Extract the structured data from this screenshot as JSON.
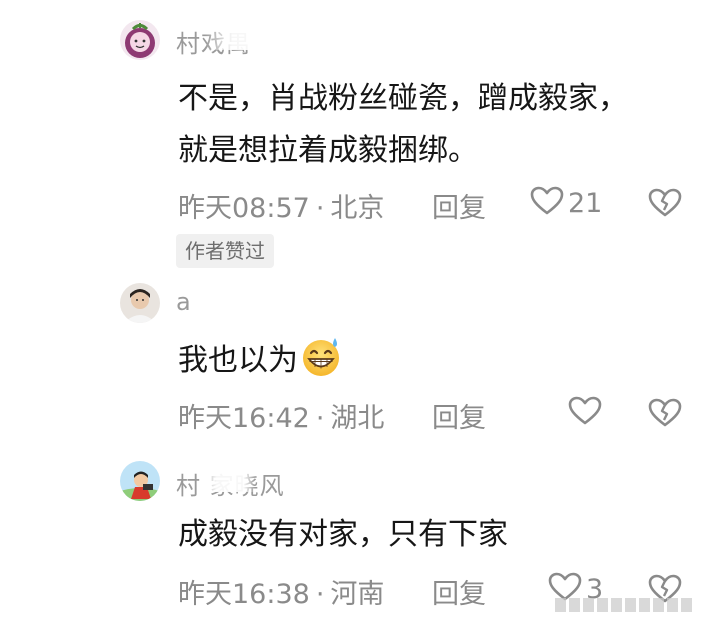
{
  "comments": [
    {
      "username": "村戏禺",
      "text_lines": [
        "不是，肖战粉丝碰瓷，蹭成毅家，",
        "就是想拉着成毅捆绑。"
      ],
      "time": "昨天08:57",
      "location": "北京",
      "reply_label": "回复",
      "like_count": "21",
      "badge": "作者赞过"
    },
    {
      "username": "a",
      "text_lines": [
        "我也以为"
      ],
      "time": "昨天16:42",
      "location": "湖北",
      "reply_label": "回复",
      "like_count": ""
    },
    {
      "username": "村    家晓风",
      "text_lines": [
        "成毅没有对家，只有下家"
      ],
      "time": "昨天16:38",
      "location": "河南",
      "reply_label": "回复",
      "like_count": "3"
    }
  ],
  "separator": "·",
  "icons": {
    "like": "heart-outline-icon",
    "dislike": "broken-heart-icon",
    "emoji": "grinning-sweat-emoji-icon"
  },
  "colors": {
    "text": "#161616",
    "meta": "#8a8a8a",
    "badge_bg": "#f0f0f0"
  }
}
